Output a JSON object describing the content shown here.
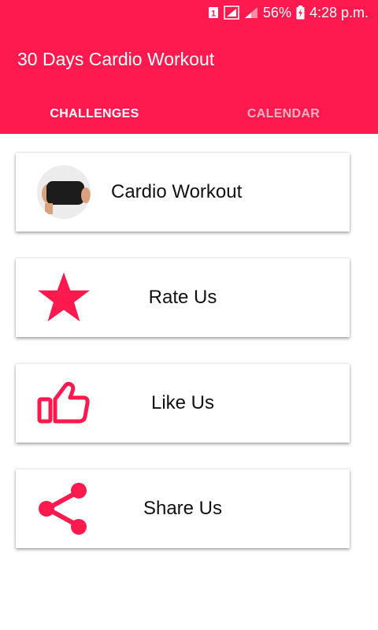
{
  "status_bar": {
    "sim_badge": "1",
    "battery_percent": "56%",
    "time": "4:28 p.m."
  },
  "app": {
    "title": "30 Days Cardio Workout",
    "accent_color": "#fe1a4e"
  },
  "tabs": [
    {
      "label": "CHALLENGES",
      "active": true
    },
    {
      "label": "CALENDAR",
      "active": false
    }
  ],
  "cards": [
    {
      "label": "Cardio Workout",
      "icon": "workout-photo"
    },
    {
      "label": "Rate Us",
      "icon": "star-icon"
    },
    {
      "label": "Like Us",
      "icon": "thumbs-up-icon"
    },
    {
      "label": "Share Us",
      "icon": "share-icon"
    }
  ]
}
